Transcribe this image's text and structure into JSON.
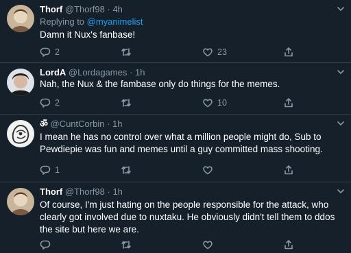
{
  "tweets": [
    {
      "name": "Thorf",
      "handle": "@Thorf98",
      "time": "4h",
      "reply_prefix": "Replying to ",
      "reply_to": "@myanimelist",
      "text": "Damn it Nux's fanbase!",
      "replies": "2",
      "retweets": "",
      "likes": "23"
    },
    {
      "name": "LordA",
      "handle": "@Lordagames",
      "time": "1h",
      "text": "Nah, the Nux & the fambase only do things for the memes.",
      "replies": "2",
      "retweets": "",
      "likes": "10"
    },
    {
      "name": "ॐ",
      "handle": "@CuntCorbin",
      "time": "1h",
      "text": "I mean he has no control over what a million people might do, Sub to Pewdiepie was fun and memes until a guy committed mass shooting.",
      "replies": "1",
      "retweets": "",
      "likes": ""
    },
    {
      "name": "Thorf",
      "handle": "@Thorf98",
      "time": "1h",
      "text": "Of course, I'm just hating on the people responsible for the attack, who clearly got involved due to nuxtaku. He obviously didn't tell them to ddos the site but here we are.",
      "replies": "",
      "retweets": "",
      "likes": ""
    }
  ],
  "separator": "·",
  "colors": {
    "background": "#15202b",
    "secondary_text": "#8899a6",
    "link": "#1da1f2",
    "divider": "#38444d"
  },
  "icons": {
    "reply": "reply-icon",
    "retweet": "retweet-icon",
    "like": "heart-icon",
    "share": "share-icon",
    "more": "chevron-down-icon"
  }
}
